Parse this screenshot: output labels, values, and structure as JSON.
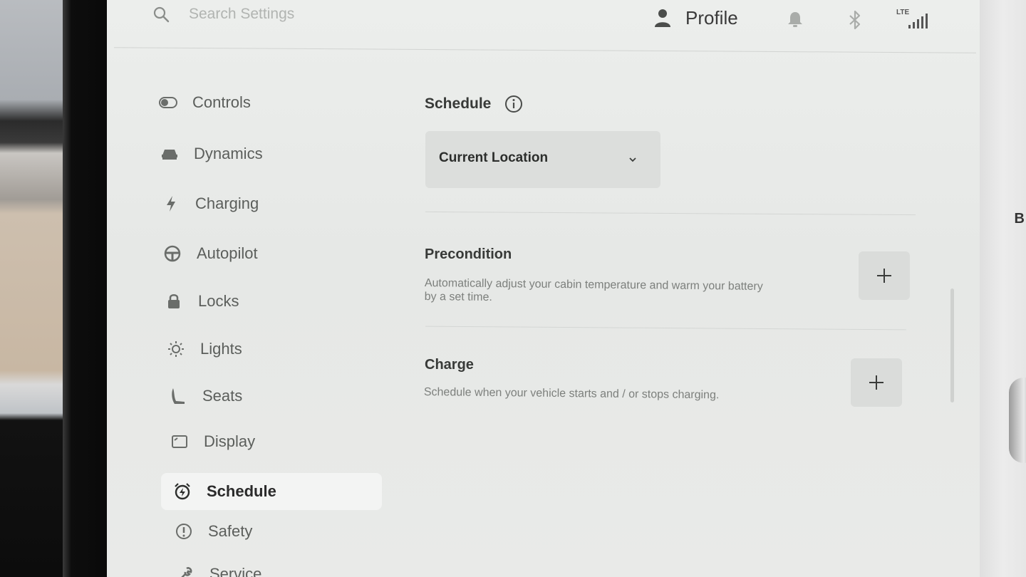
{
  "header": {
    "search_placeholder": "Search Settings",
    "profile_label": "Profile",
    "network_label": "LTE"
  },
  "sidebar": {
    "items": [
      {
        "label": "Controls",
        "icon": "toggle-icon"
      },
      {
        "label": "Dynamics",
        "icon": "car-icon"
      },
      {
        "label": "Charging",
        "icon": "lightning-icon"
      },
      {
        "label": "Autopilot",
        "icon": "steering-wheel-icon"
      },
      {
        "label": "Locks",
        "icon": "lock-icon"
      },
      {
        "label": "Lights",
        "icon": "sun-icon"
      },
      {
        "label": "Seats",
        "icon": "seat-icon"
      },
      {
        "label": "Display",
        "icon": "display-icon"
      },
      {
        "label": "Schedule",
        "icon": "alarm-clock-icon",
        "active": true
      },
      {
        "label": "Safety",
        "icon": "alert-circle-icon"
      },
      {
        "label": "Service",
        "icon": "wrench-icon"
      }
    ]
  },
  "main": {
    "schedule": {
      "title": "Schedule",
      "location_value": "Current Location"
    },
    "precondition": {
      "title": "Precondition",
      "description_line1": "Automatically adjust your cabin temperature and warm your battery",
      "description_line2": "by a set time."
    },
    "charge": {
      "title": "Charge",
      "description": "Schedule when your vehicle starts and / or stops charging."
    }
  },
  "edge_text": "B"
}
